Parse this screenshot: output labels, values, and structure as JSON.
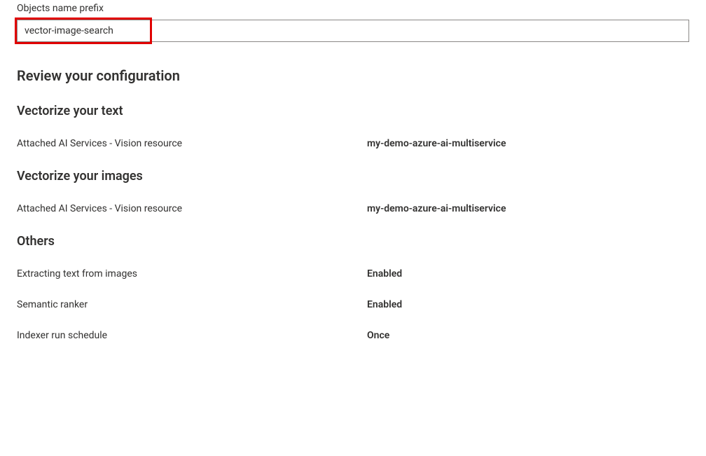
{
  "prefixField": {
    "label": "Objects name prefix",
    "value": "vector-image-search"
  },
  "reviewHeading": "Review your configuration",
  "sections": {
    "vectorizeText": {
      "heading": "Vectorize your text",
      "rows": [
        {
          "label": "Attached AI Services - Vision resource",
          "value": "my-demo-azure-ai-multiservice"
        }
      ]
    },
    "vectorizeImages": {
      "heading": "Vectorize your images",
      "rows": [
        {
          "label": "Attached AI Services - Vision resource",
          "value": "my-demo-azure-ai-multiservice"
        }
      ]
    },
    "others": {
      "heading": "Others",
      "rows": [
        {
          "label": "Extracting text from images",
          "value": "Enabled"
        },
        {
          "label": "Semantic ranker",
          "value": "Enabled"
        },
        {
          "label": "Indexer run schedule",
          "value": "Once"
        }
      ]
    }
  }
}
